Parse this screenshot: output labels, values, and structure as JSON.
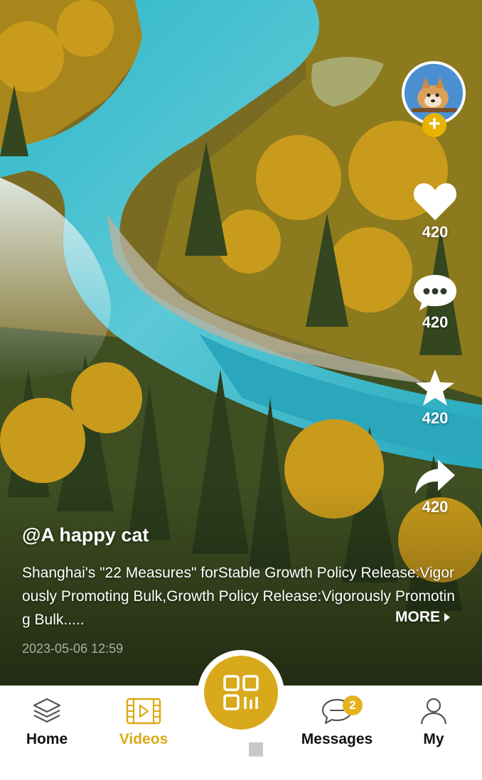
{
  "post": {
    "author": "@A happy cat",
    "description": "Shanghai's \"22 Measures\" forStable Growth Policy Release:Vigorously Promoting Bulk,Growth Policy Release:Vigorously Promoting Bulk.....",
    "more_label": "MORE",
    "timestamp": "2023-05-06  12:59"
  },
  "actions": {
    "likes": "420",
    "comments": "420",
    "favorites": "420",
    "shares": "420"
  },
  "tabs": [
    {
      "label": "Home",
      "icon": "layers-icon",
      "active": false
    },
    {
      "label": "Videos",
      "icon": "video-icon",
      "active": true
    },
    {
      "label": "",
      "icon": "scan-icon",
      "active": false
    },
    {
      "label": "Messages",
      "icon": "chat-icon",
      "active": false,
      "badge": "2"
    },
    {
      "label": "My",
      "icon": "person-icon",
      "active": false
    }
  ],
  "colors": {
    "accent": "#dcaa14",
    "center_button": "#d9a91c",
    "tab_text": "#111111"
  }
}
